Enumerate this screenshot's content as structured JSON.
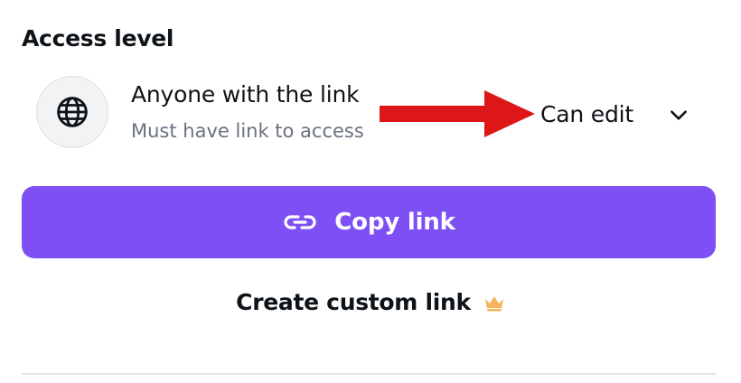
{
  "access": {
    "section_title": "Access level",
    "title": "Anyone with the link",
    "subtitle": "Must have link to access",
    "permission": "Can edit",
    "icon": "globe-icon"
  },
  "annotation": {
    "arrow_color": "#dd1717"
  },
  "actions": {
    "copy_label": "Copy link",
    "copy_icon": "link-icon",
    "custom_label": "Create custom link",
    "custom_icon": "crown-icon"
  },
  "colors": {
    "accent": "#7d4ff5",
    "crown": "#f5b25b"
  }
}
